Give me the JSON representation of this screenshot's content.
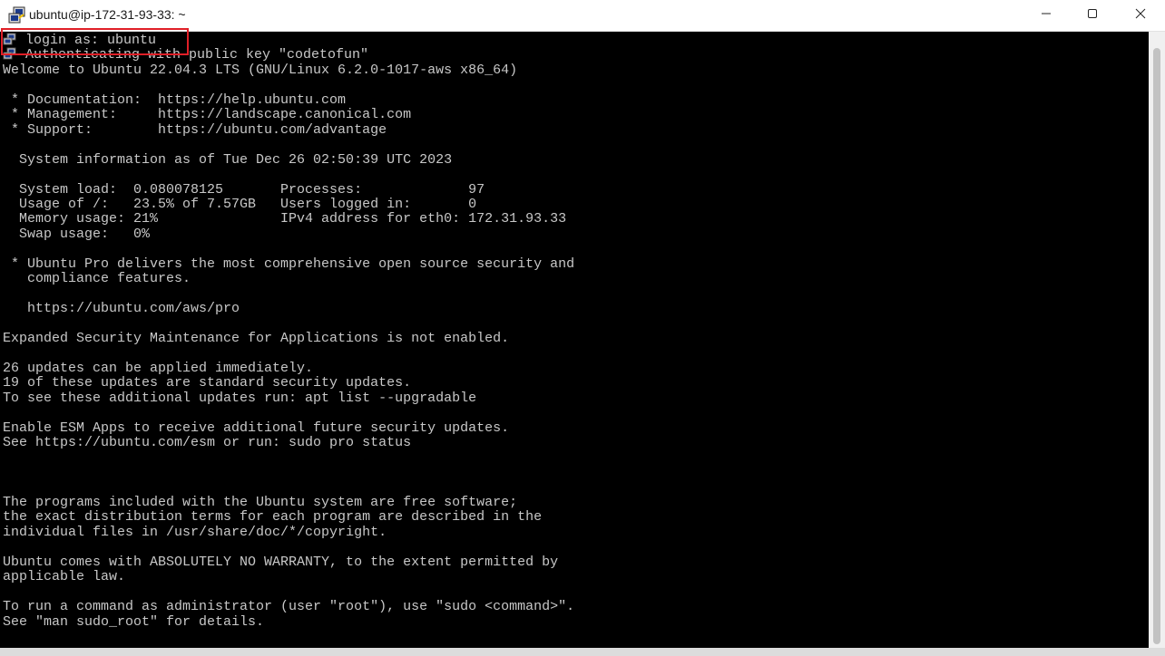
{
  "window": {
    "title": "ubuntu@ip-172-31-93-33: ~",
    "app_icon": "putty-icon",
    "controls": {
      "minimize_icon": "minimize-icon",
      "maximize_icon": "maximize-icon",
      "close_icon": "close-icon"
    }
  },
  "highlight_color": "#e01f27",
  "terminal": {
    "background": "#000000",
    "foreground": "#c8c8c8",
    "line_icon": "putty-key-icon",
    "lines": [
      "login as: ubuntu",
      "Authenticating with public key \"codetofun\"",
      "Welcome to Ubuntu 22.04.3 LTS (GNU/Linux 6.2.0-1017-aws x86_64)",
      "",
      " * Documentation:  https://help.ubuntu.com",
      " * Management:     https://landscape.canonical.com",
      " * Support:        https://ubuntu.com/advantage",
      "",
      "  System information as of Tue Dec 26 02:50:39 UTC 2023",
      "",
      "  System load:  0.080078125       Processes:             97",
      "  Usage of /:   23.5% of 7.57GB   Users logged in:       0",
      "  Memory usage: 21%               IPv4 address for eth0: 172.31.93.33",
      "  Swap usage:   0%",
      "",
      " * Ubuntu Pro delivers the most comprehensive open source security and",
      "   compliance features.",
      "",
      "   https://ubuntu.com/aws/pro",
      "",
      "Expanded Security Maintenance for Applications is not enabled.",
      "",
      "26 updates can be applied immediately.",
      "19 of these updates are standard security updates.",
      "To see these additional updates run: apt list --upgradable",
      "",
      "Enable ESM Apps to receive additional future security updates.",
      "See https://ubuntu.com/esm or run: sudo pro status",
      "",
      "",
      "",
      "The programs included with the Ubuntu system are free software;",
      "the exact distribution terms for each program are described in the",
      "individual files in /usr/share/doc/*/copyright.",
      "",
      "Ubuntu comes with ABSOLUTELY NO WARRANTY, to the extent permitted by",
      "applicable law.",
      "",
      "To run a command as administrator (user \"root\"), use \"sudo <command>\".",
      "See \"man sudo_root\" for details."
    ]
  }
}
